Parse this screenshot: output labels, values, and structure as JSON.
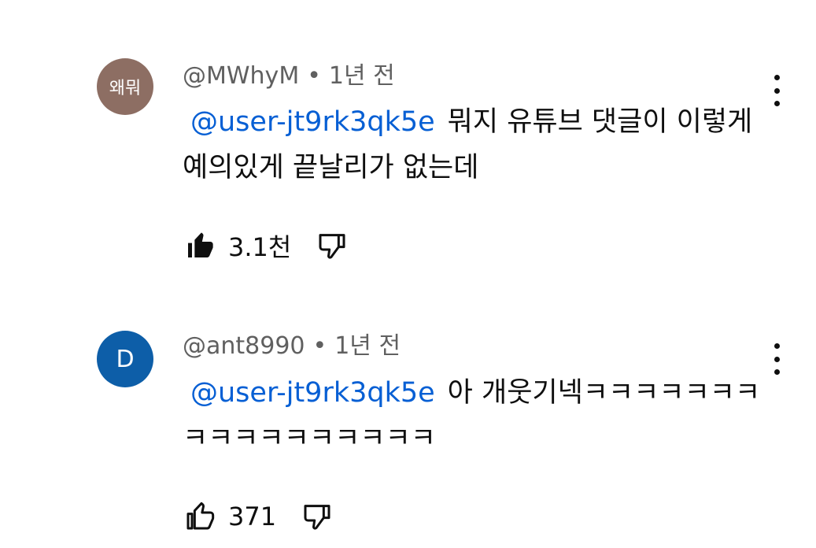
{
  "comments": [
    {
      "avatar_text": "왜뭐",
      "author": "@MWhyM",
      "separator": "•",
      "time": "1년 전",
      "mention": "@user-jt9rk3qk5e",
      "text": "뭐지 유튜브 댓글이 이렇게 예의있게 끝날리가 없는데",
      "likes": "3.1천",
      "liked": true,
      "avatar_color": "#8d6e63"
    },
    {
      "avatar_text": "D",
      "author": "@ant8990",
      "separator": "•",
      "time": "1년 전",
      "mention": "@user-jt9rk3qk5e",
      "text": "아 개웃기넥ㅋㅋㅋㅋㅋㅋㅋㅋㅋㅋㅋㅋㅋㅋㅋㅋㅋ",
      "likes": "371",
      "liked": false,
      "avatar_color": "#0d5ea8"
    }
  ],
  "icons": {
    "like": "thumbs-up-icon",
    "dislike": "thumbs-down-icon",
    "menu": "more-vert-icon"
  }
}
